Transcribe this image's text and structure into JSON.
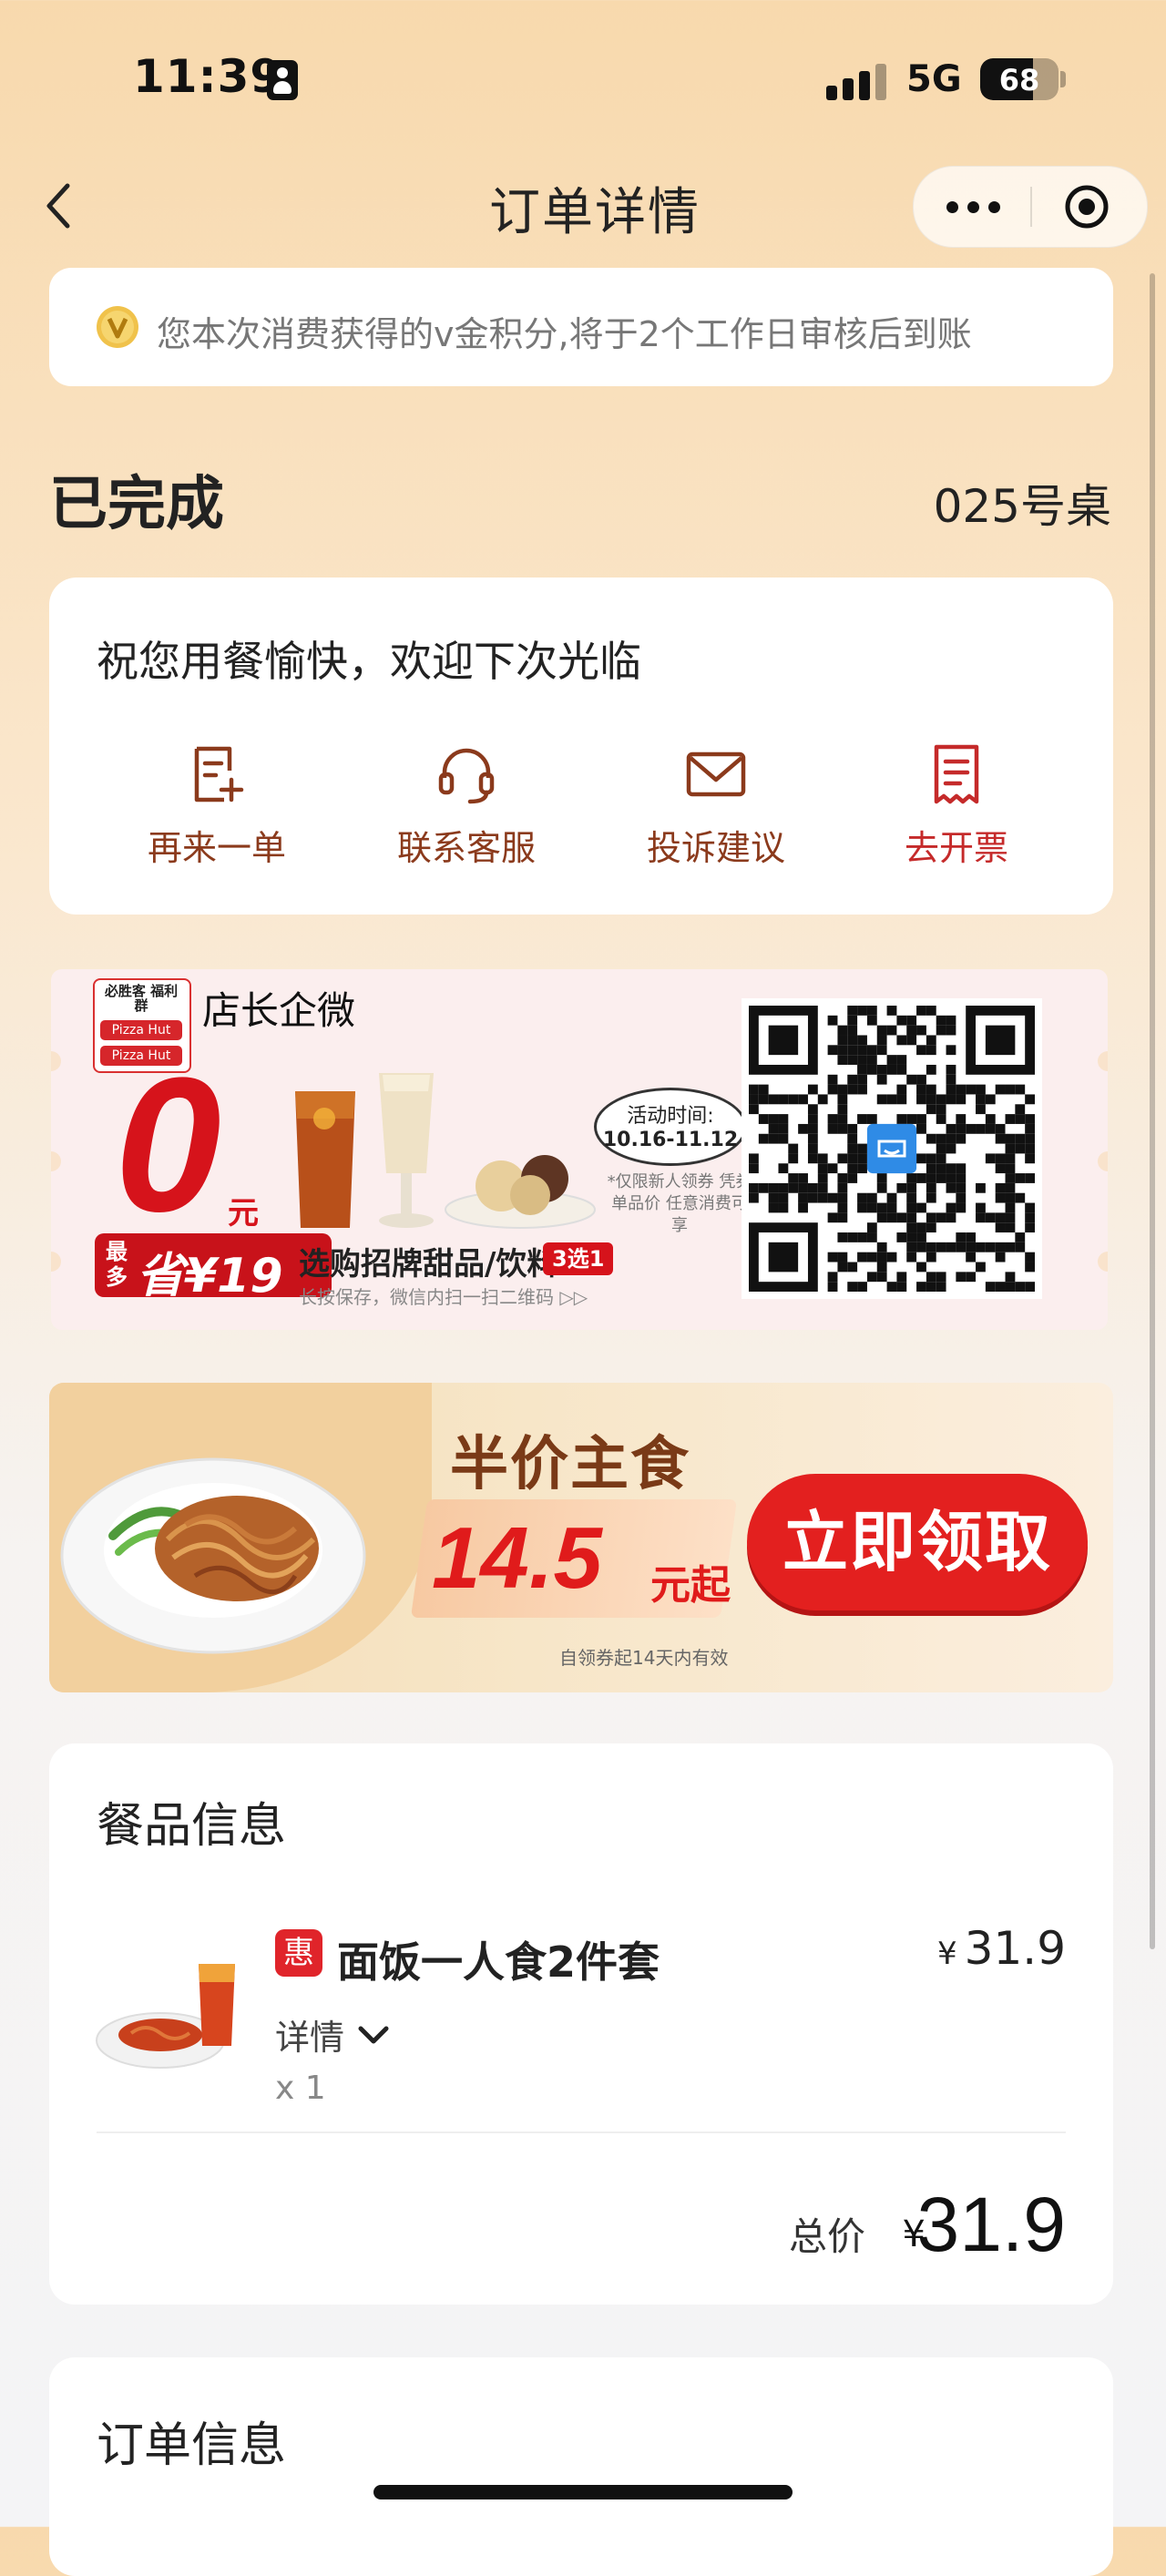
{
  "status_bar": {
    "time": "11:39",
    "network": "5G",
    "battery": "68",
    "battery_level": 0.68
  },
  "nav": {
    "title": "订单详情"
  },
  "notice": {
    "text": "您本次消费获得的v金积分,将于2个工作日审核后到账"
  },
  "order": {
    "status": "已完成",
    "table": "025号桌"
  },
  "actions": {
    "greeting": "祝您用餐愉快，欢迎下次光临",
    "items": [
      {
        "label": "再来一单",
        "icon": "reorder-icon",
        "color": "#8b3a1c"
      },
      {
        "label": "联系客服",
        "icon": "headset-icon",
        "color": "#8b3a1c"
      },
      {
        "label": "投诉建议",
        "icon": "mail-icon",
        "color": "#8b3a1c"
      },
      {
        "label": "去开票",
        "icon": "invoice-icon",
        "color": "#c52a2a"
      }
    ]
  },
  "qr_banner": {
    "manager_label": "店长企微",
    "logo_top": "必胜客 福利群",
    "logo_brand": "Pizza Hut",
    "zero": "0",
    "zero_unit": "元",
    "save_small": "最多",
    "save_main": "省¥19",
    "promo": "选购招牌甜品/饮料",
    "promo_pill": "3选1",
    "promo_note": "长按保存，微信内扫一扫二维码 ▷▷",
    "activity_label": "活动时间:",
    "activity_dates": "10.16-11.12",
    "activity_note": "*仅限新人领券 凭券单品价 任意消费可享"
  },
  "half_banner": {
    "title": "半价主食",
    "price": "14.5",
    "price_unit": "元起",
    "claim": "立即领取",
    "validity": "自领券起14天内有效"
  },
  "products": {
    "heading": "餐品信息",
    "deal_badge": "惠",
    "name": "面饭一人食2件套",
    "currency": "¥",
    "price": "31.9",
    "detail": "详情",
    "qty": "x 1",
    "total_label": "总价",
    "total_currency": "¥",
    "total": "31.9"
  },
  "order_info": {
    "heading": "订单信息"
  },
  "colors": {
    "brand_red": "#d6131b",
    "action_brown": "#8b3a1c"
  }
}
